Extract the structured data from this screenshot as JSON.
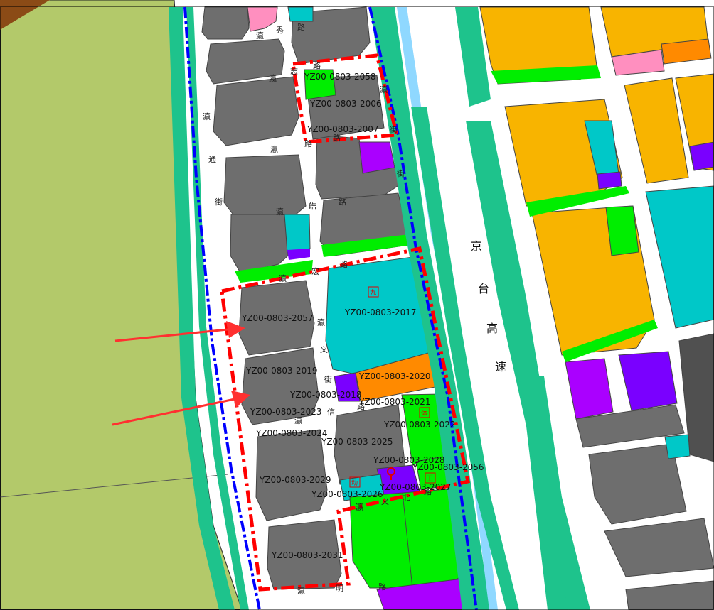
{
  "colors": {
    "background": "#ffffff",
    "farmland": "#b3c96a",
    "brown_corner": "#8b4b16",
    "gray_block": "#6e6e6e",
    "green_buffer": "#1ec38c",
    "cyan": "#00c8c8",
    "orange_industrial": "#f8b400",
    "orange_commercial": "#ff8a00",
    "bright_green": "#00ee00",
    "purple": "#aa00ff",
    "blue_purple": "#7a00ff",
    "pink": "#ff8fbf",
    "light_blue_water": "#8fd8ff",
    "boundary_red": "#ff0000",
    "arrow_red": "#ff3030",
    "district_blue": "#0000ff"
  },
  "parcels": [
    {
      "id": "YZ00-0803-2058"
    },
    {
      "id": "YZ00-0803-2006"
    },
    {
      "id": "YZ00-0803-2007"
    },
    {
      "id": "YZ00-0803-2057"
    },
    {
      "id": "YZ00-0803-2017"
    },
    {
      "id": "YZ00-0803-2019"
    },
    {
      "id": "YZ00-0803-2020"
    },
    {
      "id": "YZ00-0803-2018"
    },
    {
      "id": "YZ00-0803-2021"
    },
    {
      "id": "YZ00-0803-2023"
    },
    {
      "id": "YZ00-0803-2022"
    },
    {
      "id": "YZ00-0803-2024"
    },
    {
      "id": "YZ00-0803-2025"
    },
    {
      "id": "YZ00-0803-2028"
    },
    {
      "id": "YZ00-0803-2056"
    },
    {
      "id": "YZ00-0803-2029"
    },
    {
      "id": "YZ00-0803-2027"
    },
    {
      "id": "YZ00-0803-2026"
    },
    {
      "id": "YZ00-0803-2031"
    }
  ],
  "roads": {
    "xiu": [
      "瀛",
      "秀",
      "路"
    ],
    "tong": [
      "瀛",
      "通",
      "街"
    ],
    "hao": [
      "瀛",
      "皓",
      "路"
    ],
    "hong": [
      "瀛",
      "宏",
      "路"
    ],
    "yi": [
      "瀛",
      "义",
      "街"
    ],
    "xin": [
      "瀛",
      "信",
      "路"
    ],
    "ming": [
      "瀛",
      "明",
      "路"
    ],
    "east_street": [
      "瀛",
      "街"
    ],
    "north_road": [
      "路",
      "瀛"
    ],
    "zhi": [
      "瀛",
      "志",
      "路"
    ],
    "south": [
      "瀛",
      "义",
      "北",
      "路"
    ]
  },
  "highway": {
    "chars": [
      "京",
      "台",
      "高",
      "速"
    ]
  },
  "markers": {
    "jiu": "九",
    "ti": "体",
    "wei": "卫",
    "dong": "动"
  }
}
